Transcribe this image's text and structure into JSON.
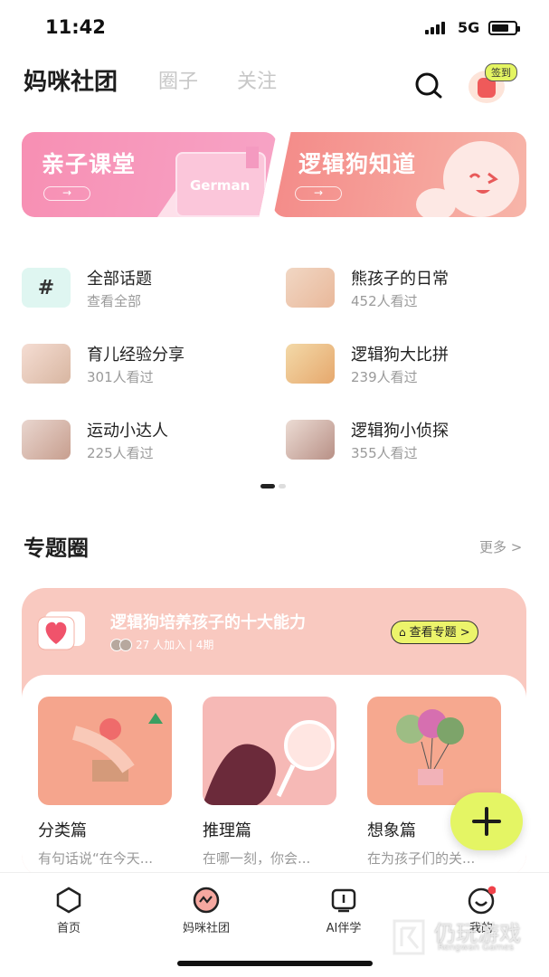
{
  "status_bar": {
    "time": "11:42",
    "network": "5G"
  },
  "header": {
    "tabs": [
      {
        "label": "妈咪社团",
        "active": true
      },
      {
        "label": "圈子",
        "active": false
      },
      {
        "label": "关注",
        "active": false
      }
    ],
    "checkin_badge": "签到"
  },
  "banners": [
    {
      "title": "亲子课堂",
      "book_text": "German",
      "color": "#f78fb3"
    },
    {
      "title": "逻辑狗知道",
      "color": "#f48a88"
    }
  ],
  "topics": [
    {
      "title": "全部话题",
      "subtitle": "查看全部",
      "icon": "hash-icon"
    },
    {
      "title": "熊孩子的日常",
      "subtitle": "452人看过"
    },
    {
      "title": "育儿经验分享",
      "subtitle": "301人看过"
    },
    {
      "title": "逻辑狗大比拼",
      "subtitle": "239人看过"
    },
    {
      "title": "运动小达人",
      "subtitle": "225人看过"
    },
    {
      "title": "逻辑狗小侦探",
      "subtitle": "355人看过"
    }
  ],
  "section": {
    "title": "专题圈",
    "more": "更多 >"
  },
  "special": {
    "title": "逻辑狗培养孩子的十大能力",
    "meta": "27 人加入 | 4期",
    "button": "查看专题 >",
    "chapters": [
      {
        "title": "分类篇",
        "desc": "有句话说“在今天..."
      },
      {
        "title": "推理篇",
        "desc": "在哪一刻，你会..."
      },
      {
        "title": "想象篇",
        "desc": "在为孩子们的关..."
      }
    ]
  },
  "tabbar": [
    {
      "label": "首页",
      "icon": "home-icon"
    },
    {
      "label": "妈咪社团",
      "icon": "community-icon"
    },
    {
      "label": "AI伴学",
      "icon": "ai-icon"
    },
    {
      "label": "我的",
      "icon": "profile-icon"
    }
  ],
  "watermark": {
    "text": "仍玩游戏",
    "sub": "Rengwan Games"
  },
  "colors": {
    "accent": "#e4f564",
    "pink": "#f78fb3",
    "coral": "#f48a88",
    "card_bg": "#f9c9c0"
  }
}
